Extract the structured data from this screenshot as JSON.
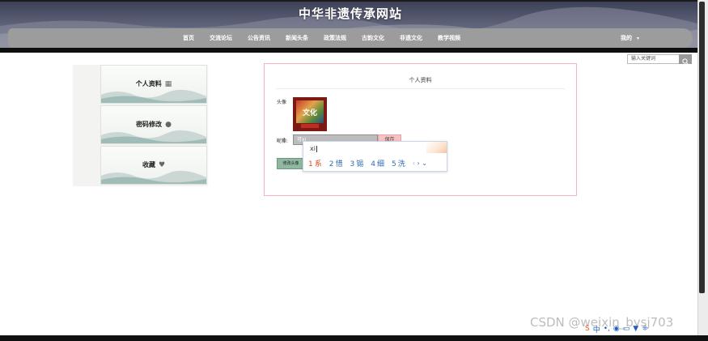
{
  "site": {
    "title": "中华非遗传承网站"
  },
  "nav": {
    "items": [
      "首页",
      "交流论坛",
      "公告资讯",
      "新闻头条",
      "政策法规",
      "古韵文化",
      "非遗文化",
      "教学视频"
    ],
    "user_label": "我的",
    "caret": "▾"
  },
  "search": {
    "placeholder": "输入关键词"
  },
  "sidebar": {
    "items": [
      {
        "label": "个人资料",
        "icon": "user-group-icon"
      },
      {
        "label": "密码修改",
        "icon": "user-icon"
      },
      {
        "label": "收藏",
        "icon": "heart-icon"
      }
    ]
  },
  "profile": {
    "title": "个人资料",
    "avatar_label": "头像",
    "avatar_caption": "文化",
    "nickname_label": "昵称:",
    "nickname_value": "可xi",
    "save_label": "保存",
    "change_avatar_label": "修改头像"
  },
  "ime": {
    "composition": "xi",
    "candidates": [
      {
        "n": "1",
        "text": "系"
      },
      {
        "n": "2",
        "text": "惜"
      },
      {
        "n": "3",
        "text": "锡"
      },
      {
        "n": "4",
        "text": "细"
      },
      {
        "n": "5",
        "text": "洗"
      }
    ],
    "prev": "‹",
    "next": "›",
    "more": "⌄"
  },
  "watermark": "CSDN @weixin_bysj703",
  "tray": {
    "ime_mode": "中",
    "punct": "•,",
    "icons": [
      "mic-icon",
      "keyboard-icon",
      "shirt-icon",
      "grid-icon"
    ]
  },
  "colors": {
    "panel_border": "#f4b6ba",
    "save_button": "#f7c2c4",
    "nav_bar": "#9c9c9c",
    "candidate_blue": "#2d6bb3",
    "candidate_first": "#e0451f"
  }
}
